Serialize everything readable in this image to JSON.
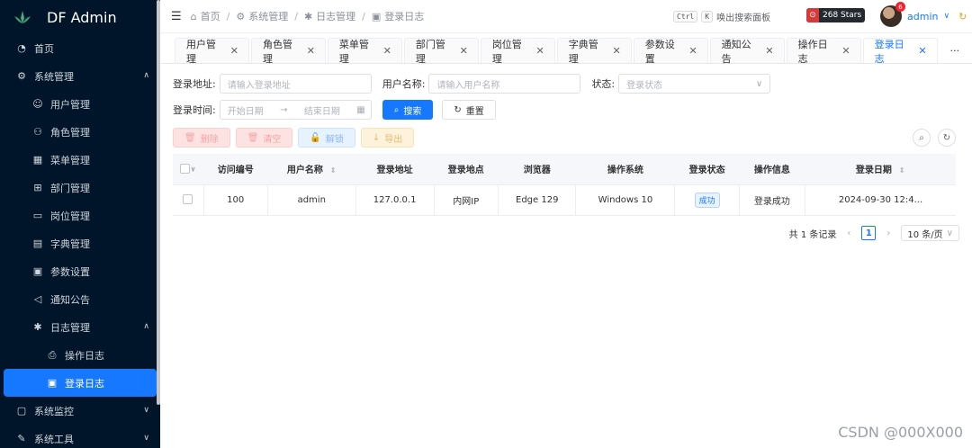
{
  "app": {
    "title": "DF Admin"
  },
  "sidebar": {
    "items": [
      {
        "label": "首页",
        "icon": "dashboard-icon",
        "level": 0
      },
      {
        "label": "系统管理",
        "icon": "gear-icon",
        "level": 0,
        "expanded": true
      },
      {
        "label": "用户管理",
        "icon": "user-icon",
        "level": 1
      },
      {
        "label": "角色管理",
        "icon": "users-icon",
        "level": 1
      },
      {
        "label": "菜单管理",
        "icon": "menu-icon",
        "level": 1
      },
      {
        "label": "部门管理",
        "icon": "org-icon",
        "level": 1
      },
      {
        "label": "岗位管理",
        "icon": "post-icon",
        "level": 1
      },
      {
        "label": "字典管理",
        "icon": "dict-icon",
        "level": 1
      },
      {
        "label": "参数设置",
        "icon": "settings-icon",
        "level": 1
      },
      {
        "label": "通知公告",
        "icon": "notice-icon",
        "level": 1
      },
      {
        "label": "日志管理",
        "icon": "bug-icon",
        "level": 1,
        "expanded": true
      },
      {
        "label": "操作日志",
        "icon": "print-icon",
        "level": 2
      },
      {
        "label": "登录日志",
        "icon": "login-log-icon",
        "level": 2,
        "active": true
      },
      {
        "label": "系统监控",
        "icon": "monitor-icon",
        "level": 0
      },
      {
        "label": "系统工具",
        "icon": "tool-icon",
        "level": 0
      }
    ]
  },
  "topbar": {
    "breadcrumb": [
      "首页",
      "系统管理",
      "日志管理",
      "登录日志"
    ],
    "kbd1": "Ctrl",
    "kbd2": "K",
    "search_hint": "唤出搜索面板",
    "stars": "268 Stars",
    "badge": "6",
    "username": "admin"
  },
  "tabs": [
    {
      "label": "用户管理",
      "active": false
    },
    {
      "label": "角色管理",
      "active": false
    },
    {
      "label": "菜单管理",
      "active": false
    },
    {
      "label": "部门管理",
      "active": false
    },
    {
      "label": "岗位管理",
      "active": false
    },
    {
      "label": "字典管理",
      "active": false
    },
    {
      "label": "参数设置",
      "active": false
    },
    {
      "label": "通知公告",
      "active": false
    },
    {
      "label": "操作日志",
      "active": false
    },
    {
      "label": "登录日志",
      "active": true
    }
  ],
  "tabs_more": "···",
  "filters": {
    "ip_label": "登录地址:",
    "ip_placeholder": "请输入登录地址",
    "user_label": "用户名称:",
    "user_placeholder": "请输入用户名称",
    "status_label": "状态:",
    "status_placeholder": "登录状态",
    "time_label": "登录时间:",
    "start_placeholder": "开始日期",
    "end_placeholder": "结束日期",
    "search_btn": "搜索",
    "reset_btn": "重置"
  },
  "toolbar": {
    "delete": "删除",
    "clear": "清空",
    "unlock": "解锁",
    "export": "导出"
  },
  "table": {
    "columns": [
      "访问编号",
      "用户名称",
      "登录地址",
      "登录地点",
      "浏览器",
      "操作系统",
      "登录状态",
      "操作信息",
      "登录日期"
    ],
    "rows": [
      [
        "100",
        "admin",
        "127.0.0.1",
        "内网IP",
        "Edge 129",
        "Windows 10",
        "成功",
        "登录成功",
        "2024-09-30 12:4..."
      ]
    ]
  },
  "pager": {
    "total": "共 1 条记录",
    "current": "1",
    "size": "10 条/页"
  },
  "watermark": "CSDN @000X000",
  "colors": {
    "sidebar": "#001529",
    "accent": "#1677ff"
  }
}
